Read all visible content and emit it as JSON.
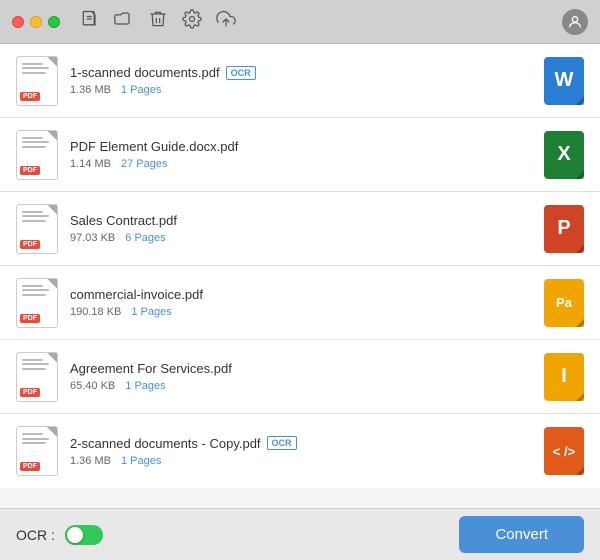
{
  "titlebar": {
    "traffic_lights": [
      "close",
      "minimize",
      "maximize"
    ],
    "avatar_label": "👤"
  },
  "files": [
    {
      "id": "file-1",
      "name": "1-scanned documents.pdf",
      "has_ocr": true,
      "size": "1.36 MB",
      "pages_label": "1 Pages",
      "format": "W",
      "format_class": "fmt-word"
    },
    {
      "id": "file-2",
      "name": "PDF Element Guide.docx.pdf",
      "has_ocr": false,
      "size": "1.14 MB",
      "pages_label": "27 Pages",
      "format": "X",
      "format_class": "fmt-excel"
    },
    {
      "id": "file-3",
      "name": "Sales Contract.pdf",
      "has_ocr": false,
      "size": "97.03 KB",
      "pages_label": "6 Pages",
      "format": "P",
      "format_class": "fmt-ppt"
    },
    {
      "id": "file-4",
      "name": "commercial-invoice.pdf",
      "has_ocr": false,
      "size": "190.18 KB",
      "pages_label": "1 Pages",
      "format": "Pa",
      "format_class": "fmt-pages"
    },
    {
      "id": "file-5",
      "name": "Agreement For Services.pdf",
      "has_ocr": false,
      "size": "65.40 KB",
      "pages_label": "1 Pages",
      "format": "I",
      "format_class": "fmt-indesign"
    },
    {
      "id": "file-6",
      "name": "2-scanned documents - Copy.pdf",
      "has_ocr": true,
      "size": "1.36 MB",
      "pages_label": "1 Pages",
      "format": "< />",
      "format_class": "fmt-code"
    }
  ],
  "bottom": {
    "ocr_label": "OCR :",
    "toggle_state": "on",
    "convert_label": "Convert"
  },
  "ocr_badge_text": "OCR"
}
